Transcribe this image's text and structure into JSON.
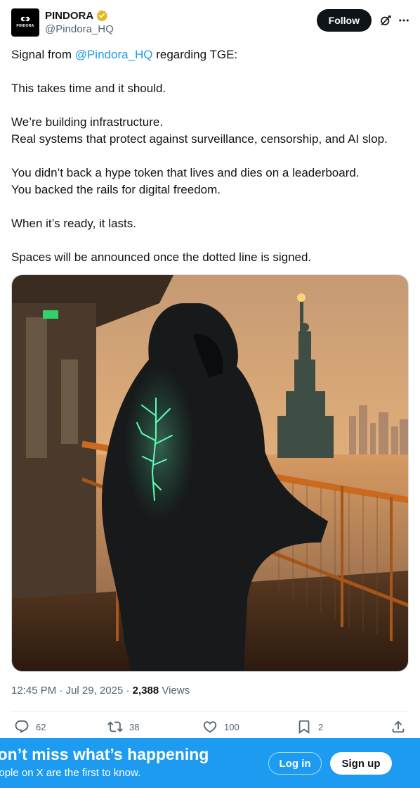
{
  "author": {
    "logo_text": "PINDORA",
    "display_name": "PINDORA",
    "handle": "@Pindora_HQ",
    "verified_icon": "verified-badge-gold"
  },
  "header": {
    "follow_label": "Follow",
    "grok_icon": "grok-icon",
    "more_icon": "more-dots-icon"
  },
  "tweet": {
    "line1_pre": "Signal from ",
    "line1_mention": "@Pindora_HQ",
    "line1_post": " regarding TGE:",
    "line2": "This takes time and it should.",
    "line3": "We’re building infrastructure.",
    "line4": "Real systems that protect against surveillance, censorship, and AI slop.",
    "line5": "You didn’t back a hype token that lives and dies on a leaderboard.",
    "line6": "You backed the rails for digital freedom.",
    "line7": "When it’s ready, it lasts.",
    "line8": "Spaces will be announced once the dotted line is signed."
  },
  "meta": {
    "time": "12:45 PM",
    "date": "Jul 29, 2025",
    "separator": " · ",
    "views_count": "2,388",
    "views_label": "Views"
  },
  "actions": {
    "replies": "62",
    "reposts": "38",
    "likes": "100",
    "bookmarks": "2"
  },
  "banner": {
    "title": "Don’t miss what’s happening",
    "subtitle": "People on X are the first to know.",
    "login_label": "Log in",
    "signup_label": "Sign up"
  },
  "colors": {
    "accent": "#1d9bf0",
    "text": "#0f1419",
    "muted": "#536471",
    "verified": "#e2b719"
  }
}
